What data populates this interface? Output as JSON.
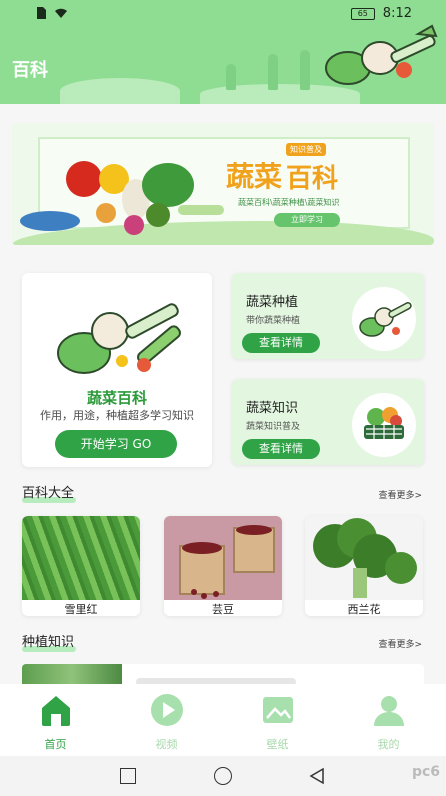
{
  "status_bar": {
    "time": "8:12",
    "battery": "65"
  },
  "header": {
    "title": "百科"
  },
  "banner": {
    "title_a": "蔬菜",
    "title_b": "百科",
    "tag": "知识普及",
    "subtitle": "蔬菜百科\\蔬菜种植\\蔬菜知识",
    "button": "立即学习"
  },
  "main_card": {
    "title": "蔬菜百科",
    "desc": "作用，用途，种植超多学习知识",
    "button": "开始学习 GO"
  },
  "side_cards": [
    {
      "title": "蔬菜种植",
      "desc": "带你蔬菜种植",
      "button": "查看详情"
    },
    {
      "title": "蔬菜知识",
      "desc": "蔬菜知识普及",
      "button": "查看详情"
    }
  ],
  "encyclopedia": {
    "title": "百科大全",
    "more": "查看更多>",
    "items": [
      {
        "label": "雪里红"
      },
      {
        "label": "芸豆"
      },
      {
        "label": "西兰花"
      }
    ]
  },
  "planting": {
    "title": "种植知识",
    "more": "查看更多>"
  },
  "tabs": [
    {
      "label": "首页",
      "icon": "home-icon",
      "active": true
    },
    {
      "label": "视频",
      "icon": "play-icon",
      "active": false
    },
    {
      "label": "壁纸",
      "icon": "wallpaper-icon",
      "active": false
    },
    {
      "label": "我的",
      "icon": "user-icon",
      "active": false
    }
  ],
  "watermark": "pc6",
  "colors": {
    "primary": "#2fa346",
    "header": "#8fdc93",
    "accent": "#f1a21d",
    "card_tint": "#e3f7e0"
  }
}
